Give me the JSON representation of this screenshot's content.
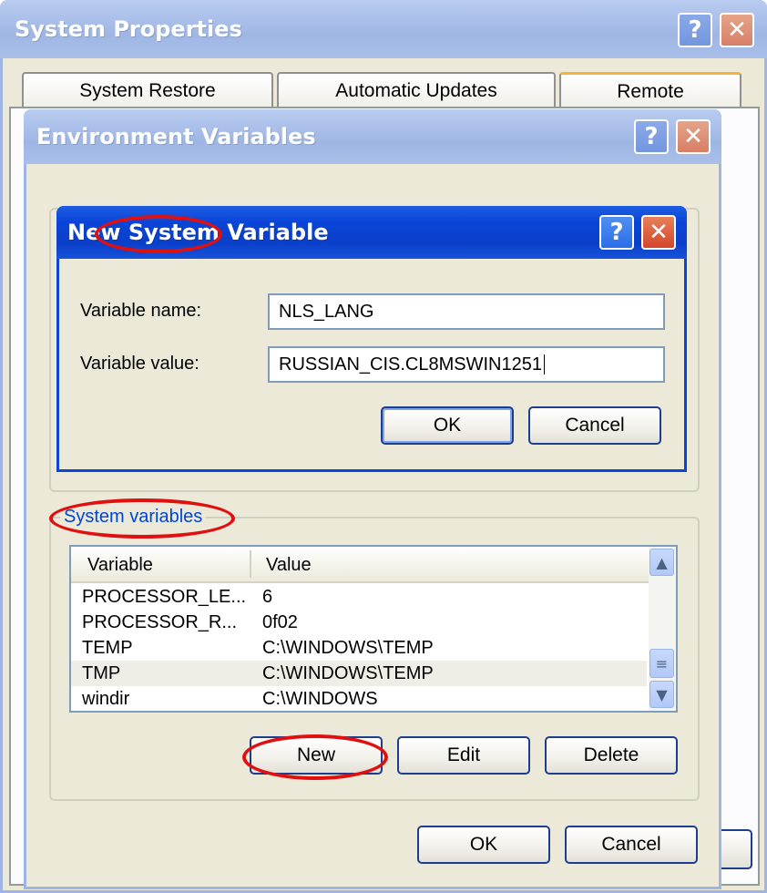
{
  "system_properties": {
    "title": "System Properties",
    "help_button": "?",
    "close_button": "✕",
    "tabs": [
      {
        "label": "System Restore"
      },
      {
        "label": "Automatic Updates"
      },
      {
        "label": "Remote"
      }
    ]
  },
  "environment_variables": {
    "title": "Environment Variables",
    "help_button": "?",
    "close_button": "✕",
    "system_variables_label": "System variables",
    "columns": [
      "Variable",
      "Value"
    ],
    "rows": [
      {
        "variable": "PROCESSOR_LE...",
        "value": "6"
      },
      {
        "variable": "PROCESSOR_R...",
        "value": "0f02"
      },
      {
        "variable": "TEMP",
        "value": "C:\\WINDOWS\\TEMP"
      },
      {
        "variable": "TMP",
        "value": "C:\\WINDOWS\\TEMP"
      },
      {
        "variable": "windir",
        "value": "C:\\WINDOWS"
      }
    ],
    "buttons": {
      "new": "New",
      "edit": "Edit",
      "delete": "Delete",
      "ok": "OK",
      "cancel": "Cancel"
    }
  },
  "new_system_variable": {
    "title": "New System Variable",
    "help_button": "?",
    "close_button": "✕",
    "name_label": "Variable name:",
    "name_value": "NLS_LANG",
    "value_label": "Variable value:",
    "value_value": "RUSSIAN_CIS.CL8MSWIN1251",
    "ok": "OK",
    "cancel": "Cancel"
  },
  "colors": {
    "active_title": "#0a45d8",
    "inactive_title": "#a9bfe9",
    "dialog_bg": "#ece9d8",
    "highlight_ellipse": "#e01010"
  }
}
